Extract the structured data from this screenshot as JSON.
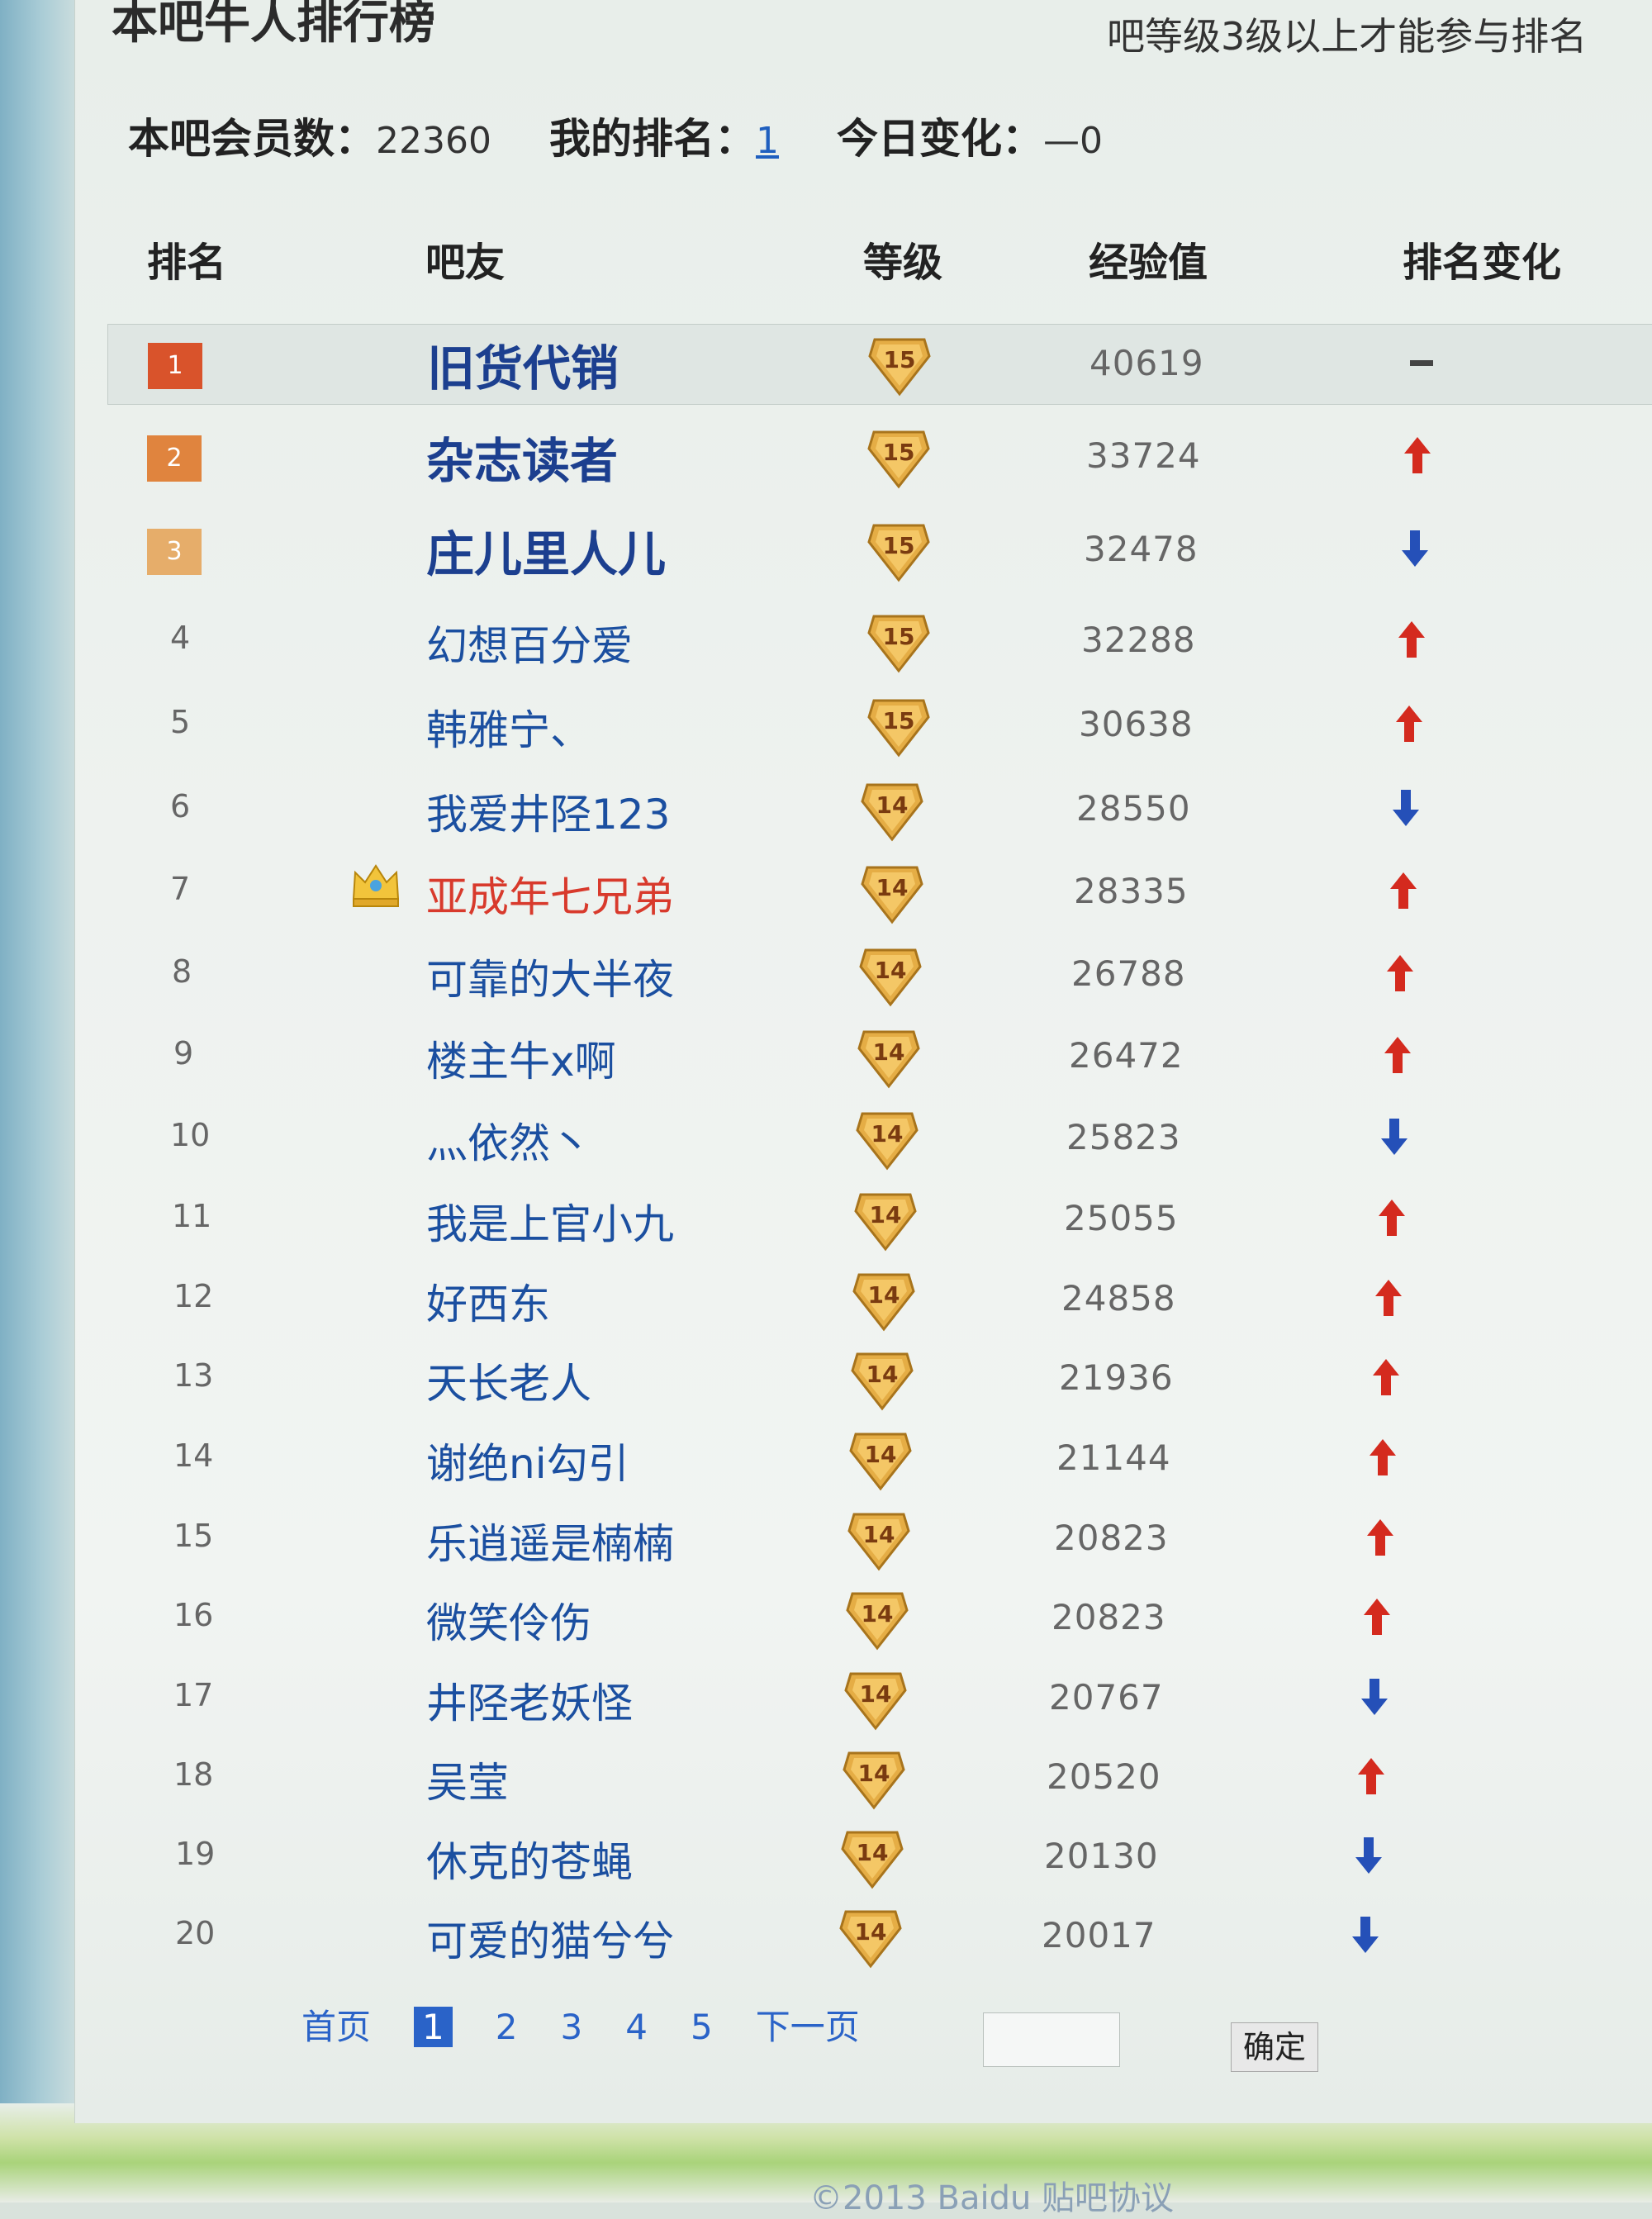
{
  "board": {
    "title": "本吧牛人排行榜",
    "note": "吧等级3级以上才能参与排名"
  },
  "stats": {
    "members_label": "本吧会员数：",
    "members_value": "22360",
    "my_rank_label": "我的排名：",
    "my_rank_value": "1",
    "today_label": "今日变化：",
    "today_value": "—0"
  },
  "headers": {
    "rank": "排名",
    "user": "吧友",
    "level": "等级",
    "exp": "经验值",
    "change": "排名变化"
  },
  "rows": [
    {
      "rank": "1",
      "name": "旧货代销",
      "level": "15",
      "exp": "40619",
      "change": "same"
    },
    {
      "rank": "2",
      "name": "杂志读者",
      "level": "15",
      "exp": "33724",
      "change": "up"
    },
    {
      "rank": "3",
      "name": "庄儿里人儿",
      "level": "15",
      "exp": "32478",
      "change": "down"
    },
    {
      "rank": "4",
      "name": "幻想百分爱",
      "level": "15",
      "exp": "32288",
      "change": "up"
    },
    {
      "rank": "5",
      "name": "韩雅宁、",
      "level": "15",
      "exp": "30638",
      "change": "up"
    },
    {
      "rank": "6",
      "name": "我爱井陉123",
      "level": "14",
      "exp": "28550",
      "change": "down"
    },
    {
      "rank": "7",
      "name": "亚成年七兄弟",
      "level": "14",
      "exp": "28335",
      "change": "up"
    },
    {
      "rank": "8",
      "name": "可靠的大半夜",
      "level": "14",
      "exp": "26788",
      "change": "up"
    },
    {
      "rank": "9",
      "name": "楼主牛x啊",
      "level": "14",
      "exp": "26472",
      "change": "up"
    },
    {
      "rank": "10",
      "name": "灬依然丶",
      "level": "14",
      "exp": "25823",
      "change": "down"
    },
    {
      "rank": "11",
      "name": "我是上官小九",
      "level": "14",
      "exp": "25055",
      "change": "up"
    },
    {
      "rank": "12",
      "name": "好西东",
      "level": "14",
      "exp": "24858",
      "change": "up"
    },
    {
      "rank": "13",
      "name": "天长老人",
      "level": "14",
      "exp": "21936",
      "change": "up"
    },
    {
      "rank": "14",
      "name": "谢绝ni勾引",
      "level": "14",
      "exp": "21144",
      "change": "up"
    },
    {
      "rank": "15",
      "name": "乐逍遥是楠楠",
      "level": "14",
      "exp": "20823",
      "change": "up"
    },
    {
      "rank": "16",
      "name": "微笑伶伤",
      "level": "14",
      "exp": "20823",
      "change": "up"
    },
    {
      "rank": "17",
      "name": "井陉老妖怪",
      "level": "14",
      "exp": "20767",
      "change": "down"
    },
    {
      "rank": "18",
      "name": "吴莹",
      "level": "14",
      "exp": "20520",
      "change": "up"
    },
    {
      "rank": "19",
      "name": "休克的苍蝇",
      "level": "14",
      "exp": "20130",
      "change": "down"
    },
    {
      "rank": "20",
      "name": "可爱的猫兮兮",
      "level": "14",
      "exp": "20017",
      "change": "down"
    }
  ],
  "change_icons": {
    "up": "red-up-arrow-icon",
    "down": "blue-down-arrow-icon",
    "same": "dash-icon"
  },
  "pager": {
    "first": "首页",
    "pages": [
      "1",
      "2",
      "3",
      "4",
      "5"
    ],
    "current": "1",
    "next": "下一页",
    "confirm": "确定"
  },
  "footer": "©2013 Baidu 贴吧协议"
}
